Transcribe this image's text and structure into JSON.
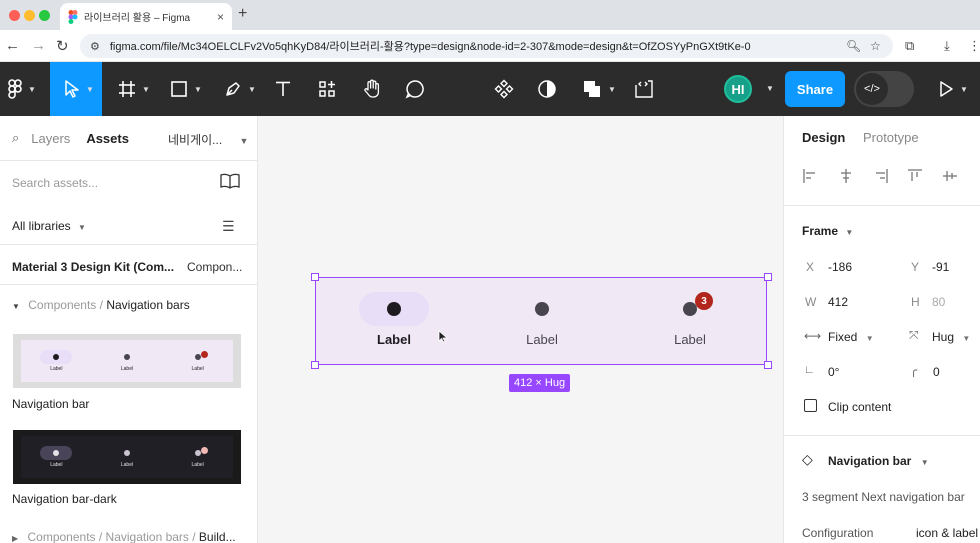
{
  "browser": {
    "tab_title": "라이브러리 활용 – Figma",
    "url": "figma.com/file/Mc34OELCLFv2Vo5qhKyD84/라이브러리-활용?type=design&node-id=2-307&mode=design&t=OfZOSYyPnGXt9tKe-0",
    "new_tab": "+",
    "close_tab": "×"
  },
  "toolbar": {
    "avatar_initials": "HI",
    "share_label": "Share",
    "devmode_glyph": "</>"
  },
  "left_panel": {
    "tab_layers": "Layers",
    "tab_assets": "Assets",
    "page_name": "네비게이...",
    "search_placeholder": "Search assets...",
    "libraries_filter": "All libraries",
    "library_name": "Material 3 Design Kit (Com...",
    "library_type": "Compon...",
    "section_path_prefix": "Components / ",
    "section_path_name": "Navigation bars",
    "components": [
      {
        "name": "Navigation bar",
        "theme": "light"
      },
      {
        "name": "Navigation bar-dark",
        "theme": "dark"
      }
    ],
    "bottom_path_prefix": "Components / Navigation bars / ",
    "bottom_path_name": "Build..."
  },
  "canvas": {
    "nav_items": [
      {
        "label": "Label",
        "active": true
      },
      {
        "label": "Label",
        "active": false
      },
      {
        "label": "Label",
        "active": false,
        "badge": "3"
      }
    ],
    "size_badge": "412 × Hug"
  },
  "right_panel": {
    "tab_design": "Design",
    "tab_prototype": "Prototype",
    "section_frame": "Frame",
    "x_label": "X",
    "x_value": "-186",
    "y_label": "Y",
    "y_value": "-91",
    "w_label": "W",
    "w_value": "412",
    "h_label": "H",
    "h_value": "80",
    "width_mode": "Fixed",
    "height_mode": "Hug",
    "rotation": "0°",
    "radius": "0",
    "clip_content": "Clip content",
    "component_name": "Navigation bar",
    "component_desc": "3 segment Next navigation bar",
    "config_label": "Configuration",
    "config_value": "icon & label"
  },
  "colors": {
    "accent": "#0d99ff",
    "selection": "#9747ff",
    "frame_fill": "#f0e8f5",
    "badge": "#b3261e"
  }
}
